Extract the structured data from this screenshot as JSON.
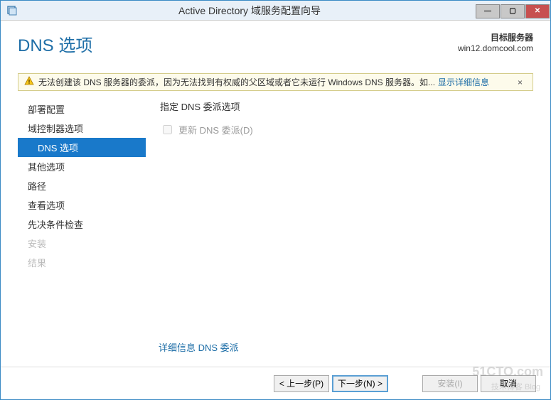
{
  "window": {
    "title": "Active Directory 域服务配置向导"
  },
  "header": {
    "page_title": "DNS 选项",
    "target_label": "目标服务器",
    "target_value": "win12.domcool.com"
  },
  "warning": {
    "text": "无法创建该 DNS 服务器的委派，因为无法找到有权威的父区域或者它未运行 Windows DNS 服务器。如...",
    "link": "显示详细信息",
    "close": "×"
  },
  "sidebar": {
    "items": [
      {
        "label": "部署配置",
        "state": "normal"
      },
      {
        "label": "域控制器选项",
        "state": "normal"
      },
      {
        "label": "DNS 选项",
        "state": "active"
      },
      {
        "label": "其他选项",
        "state": "normal"
      },
      {
        "label": "路径",
        "state": "normal"
      },
      {
        "label": "查看选项",
        "state": "normal"
      },
      {
        "label": "先决条件检查",
        "state": "normal"
      },
      {
        "label": "安装",
        "state": "disabled"
      },
      {
        "label": "结果",
        "state": "disabled"
      }
    ]
  },
  "main": {
    "section_text": "指定 DNS 委派选项",
    "checkbox_label": "更新 DNS 委派(D)",
    "more_info_link": "详细信息 DNS 委派"
  },
  "footer": {
    "prev": "< 上一步(P)",
    "next": "下一步(N) >",
    "install": "安装(I)",
    "cancel": "取消"
  },
  "watermark": {
    "main": "51CTO.com",
    "sub": "技术博客 Blog"
  }
}
